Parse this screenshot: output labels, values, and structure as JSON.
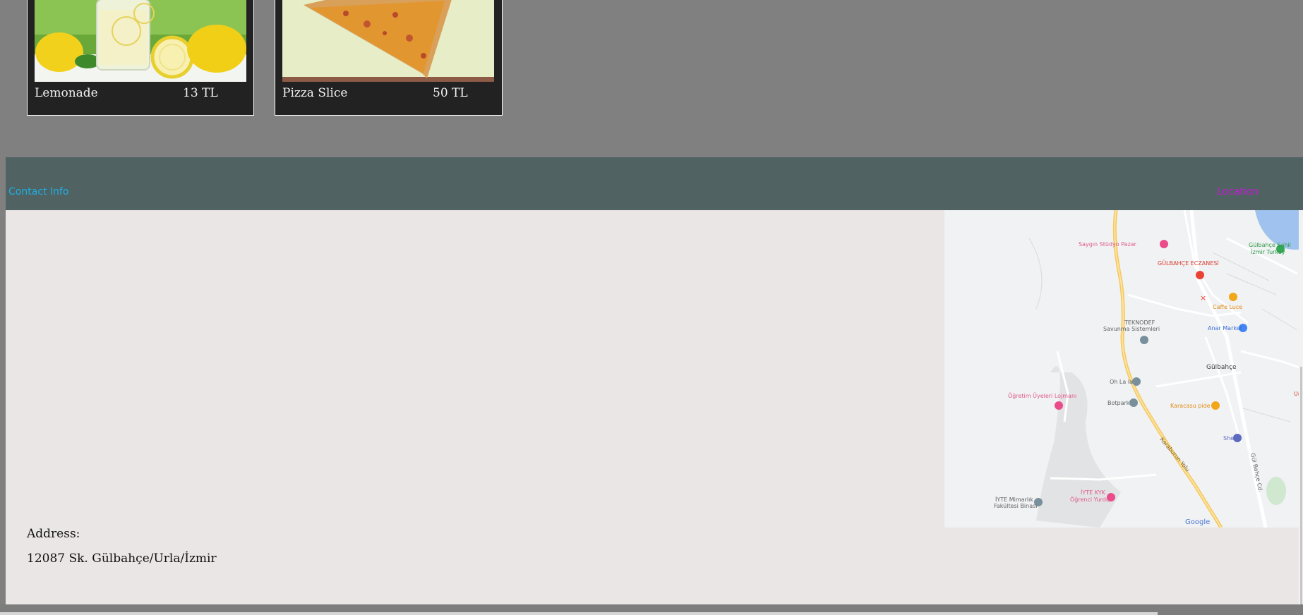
{
  "menu_items": [
    {
      "name": "Lemonade",
      "price": "13 TL"
    },
    {
      "name": "Pizza Slice",
      "price": "50 TL"
    }
  ],
  "contact": {
    "title": "Contact Info",
    "location_title": "Location",
    "address_label": "Address:",
    "address_value": "12087 Sk. Gülbahçe/Urla/İzmir"
  },
  "map": {
    "places": [
      "Saygın Stüdyo Pazar",
      "GÜLBAHÇE ECZANESİ",
      "Gülbahçe Sahil",
      "İzmir Turkey",
      "Caffe Luce",
      "TEKNODEF",
      "Savunma Sistemleri",
      "Anar Market",
      "Gülbahçe",
      "Oh La la",
      "Öğretim Üyeleri Lojmanı",
      "Botpark",
      "Karacasu pide",
      "Shell",
      "İYTE KYK",
      "Öğrenci Yurdu",
      "İYTE Mimarlık",
      "Fakültesi Binası",
      "Karaburun Yolu",
      "Gül Bahçe Cd.",
      "Urla",
      "Google"
    ]
  },
  "colors": {
    "page_bg": "#808080",
    "card_bg": "#222222",
    "header_bg": "#516263",
    "contact_title": "#1eaee0",
    "location_title": "#c21cd3",
    "body_bg": "#eae6e5"
  }
}
